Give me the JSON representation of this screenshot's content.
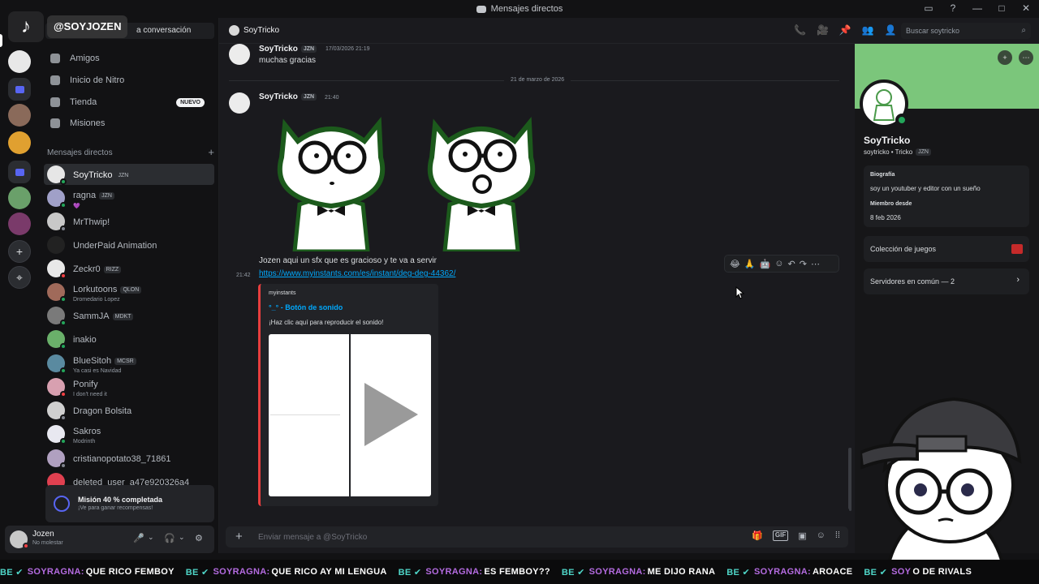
{
  "window": {
    "title": "Mensajes directos",
    "controls": [
      "▭",
      "?",
      "—",
      "□",
      "✕"
    ]
  },
  "overlay": {
    "tiktok_logo": "♪",
    "tiktok_handle": "@SOYJOZEN"
  },
  "sidebar": {
    "search_text": "a conversación",
    "nav": [
      {
        "label": "Amigos",
        "icon": "friends-icon"
      },
      {
        "label": "Inicio de Nitro",
        "icon": "nitro-icon"
      },
      {
        "label": "Tienda",
        "icon": "shop-icon",
        "badge": "NUEVO"
      },
      {
        "label": "Misiones",
        "icon": "quests-icon"
      }
    ],
    "dm_header": "Mensajes directos",
    "dm_add": "+",
    "dms": [
      {
        "name": "SoyTricko",
        "tag": "JZN",
        "sub": "",
        "status": "#23a55a"
      },
      {
        "name": "ragna",
        "tag": "JZN",
        "sub": "💜",
        "status": "#23a55a"
      },
      {
        "name": "MrThwip!",
        "tag": "",
        "sub": "",
        "status": "#80848e"
      },
      {
        "name": "UnderPaid Animation",
        "tag": "",
        "sub": "",
        "status": ""
      },
      {
        "name": "Zeckr0",
        "tag": "RIZZ",
        "sub": "",
        "status": "#f23f43"
      },
      {
        "name": "Lorkutoons",
        "tag": "QLON",
        "sub": "Dromedario Lopez",
        "status": "#23a55a"
      },
      {
        "name": "SammJA",
        "tag": "MDKT",
        "sub": "",
        "status": "#23a55a"
      },
      {
        "name": "inakio",
        "tag": "",
        "sub": "",
        "status": "#23a55a"
      },
      {
        "name": "BlueSitoh",
        "tag": "MCSR",
        "sub": "Ya casi es Navidad",
        "status": "#23a55a"
      },
      {
        "name": "Ponify",
        "tag": "",
        "sub": "I don't need it",
        "status": "#f23f43"
      },
      {
        "name": "Dragon Bolsita",
        "tag": "",
        "sub": "",
        "status": "#80848e"
      },
      {
        "name": "Sakros",
        "tag": "",
        "sub": "Modrinth",
        "status": "#23a55a"
      },
      {
        "name": "cristianopotato38_71861",
        "tag": "",
        "sub": "",
        "status": "#80848e"
      },
      {
        "name": "deleted_user_a47e920326a4",
        "tag": "",
        "sub": "",
        "status": "#f23f43"
      }
    ]
  },
  "mission": {
    "title": "Misión 40 % completada",
    "subtitle": "¡Ve para ganar recompensas!",
    "progress_percent": 40
  },
  "user": {
    "name": "Jozen",
    "status": "No molestar",
    "controls": [
      "🎤",
      "⌄",
      "🎧",
      "⌄",
      "⚙"
    ]
  },
  "chat_header": {
    "title": "SoyTricko",
    "icons": [
      "📞",
      "🎥",
      "📌",
      "👥",
      "👤"
    ],
    "search_placeholder": "Buscar soytricko",
    "search_icon": "⌕"
  },
  "messages": {
    "m1": {
      "author": "SoyTricko",
      "tag": "JZN",
      "time": "17/03/2026 21:19",
      "text": "muchas gracias"
    },
    "divider": "21 de marzo de 2026",
    "m2": {
      "author": "SoyTricko",
      "tag": "JZN",
      "time": "21:40",
      "text": "Jozen aqui un sfx que es gracioso y te va a servir",
      "hover_time": "21:42",
      "link": "https://www.myinstants.com/es/instant/deg-deg-44362/"
    },
    "embed": {
      "provider": "myinstants",
      "title": "°_° - Botón de sonido",
      "description": "¡Haz clic aquí para reproducir el sonido!"
    },
    "toolbar": [
      "😂",
      "🙏",
      "🤖",
      "☺",
      "↶",
      "↷",
      "⋯"
    ]
  },
  "composer": {
    "placeholder": "Enviar mensaje a @SoyTricko",
    "plus": "+",
    "icons": [
      "🎁",
      "GIF",
      "▣",
      "☺",
      "⁞⁞"
    ]
  },
  "profile": {
    "name": "SoyTricko",
    "handle": "soytricko • Tricko",
    "tag": "JZN",
    "bio_label": "Biografía",
    "bio": "soy un youtuber y editor con un sueño",
    "member_label": "Miembro desde",
    "member_since": "8 feb 2026",
    "games_label": "Colección de juegos",
    "servers_label": "Servidores en común — 2",
    "chevron": "›",
    "banner_color": "#7bc67b"
  },
  "ticker": [
    {
      "badge": "BE ✔",
      "name": "SOYRAGNA:",
      "msg": "QUE RICO FEMBOY"
    },
    {
      "badge": "BE ✔",
      "name": "SOYRAGNA:",
      "msg": "QUE RICO AY MI LENGUA"
    },
    {
      "badge": "BE ✔",
      "name": "SOYRAGNA:",
      "msg": "ES FEMBOY??"
    },
    {
      "badge": "BE ✔",
      "name": "SOYRAGNA:",
      "msg": "ME DIJO RANA"
    },
    {
      "badge": "BE ✔",
      "name": "SOYRAGNA:",
      "msg": "AROACE"
    },
    {
      "badge": "BE ✔",
      "name": "SOY",
      "msg": "O DE RIVALS"
    }
  ]
}
